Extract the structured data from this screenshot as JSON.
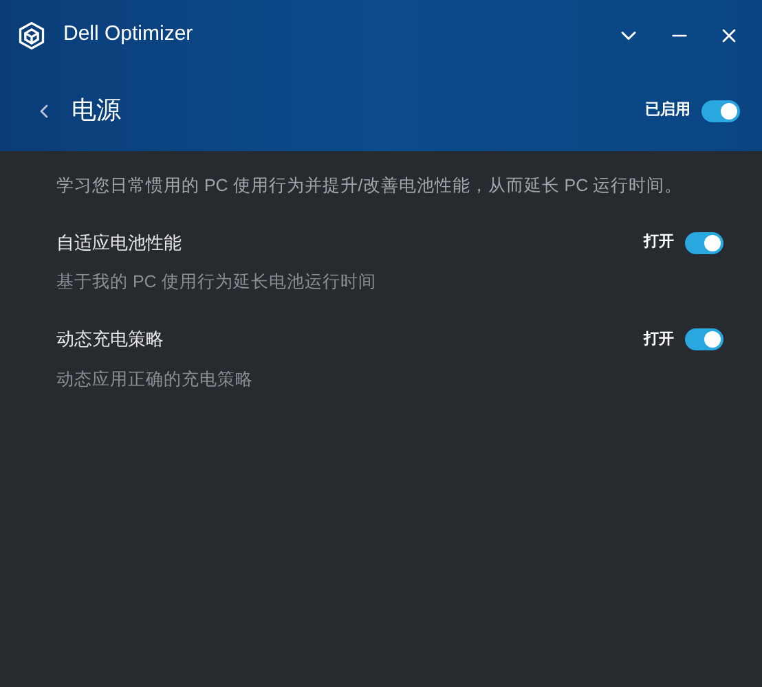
{
  "window": {
    "title": "Dell Optimizer"
  },
  "page": {
    "title": "电源",
    "status_label": "已启用",
    "enabled": true
  },
  "description": "学习您日常惯用的 PC 使用行为并提升/改善电池性能，从而延长 PC 运行时间。",
  "settings": [
    {
      "name": "自适应电池性能",
      "description": "基于我的 PC 使用行为延长电池运行时间",
      "state_label": "打开",
      "on": true
    },
    {
      "name": "动态充电策略",
      "description": "动态应用正确的充电策略",
      "state_label": "打开",
      "on": true
    }
  ]
}
